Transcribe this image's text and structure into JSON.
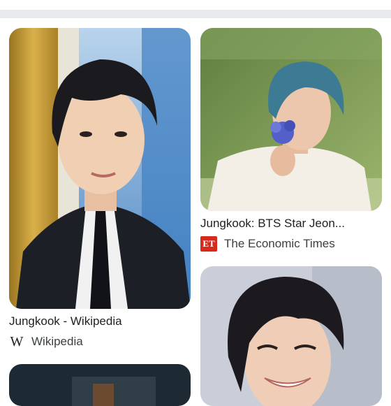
{
  "results": [
    {
      "title": "Jungkook - Wikipedia",
      "source": "Wikipedia",
      "source_icon": "wikipedia-w-icon"
    },
    {
      "title": "Jungkook: BTS Star Jeon...",
      "source": "The Economic Times",
      "source_icon": "economic-times-icon",
      "source_icon_text": "ET"
    }
  ],
  "colors": {
    "economic_times_red": "#d62b1c",
    "divider_bar": "#e8eaed"
  }
}
